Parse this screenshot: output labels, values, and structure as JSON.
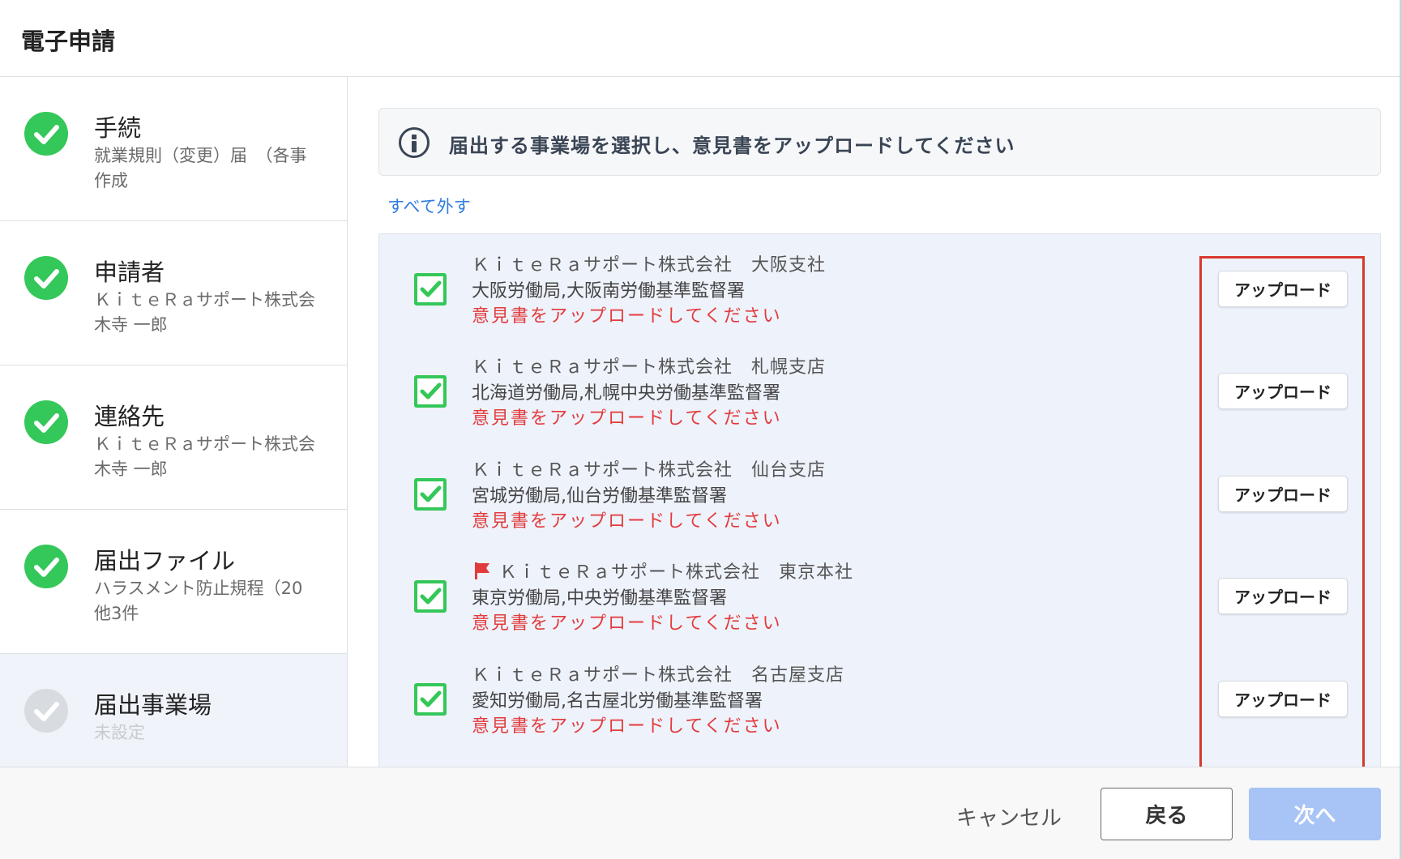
{
  "header": {
    "title": "電子申請"
  },
  "sidebar": {
    "steps": [
      {
        "title": "手続",
        "sub1": "就業規則（変更）届　（各事",
        "sub2": "作成",
        "status": "done"
      },
      {
        "title": "申請者",
        "sub1": "ＫｉｔｅＲａサポート株式会",
        "sub2": "木寺 一郎",
        "status": "done"
      },
      {
        "title": "連絡先",
        "sub1": "ＫｉｔｅＲａサポート株式会",
        "sub2": "木寺 一郎",
        "status": "done"
      },
      {
        "title": "届出ファイル",
        "sub1": "ハラスメント防止規程（20",
        "sub2": "他3件",
        "status": "done"
      },
      {
        "title": "届出事業場",
        "sub1": "未設定",
        "status": "pending"
      }
    ]
  },
  "main": {
    "info_message": "届出する事業場を選択し、意見書をアップロードしてください",
    "clear_all_label": "すべて外す",
    "upload_label": "アップロード",
    "offices": [
      {
        "company": "ＫｉｔｅＲａサポート株式会社　大阪支社",
        "office": "大阪労働局,大阪南労働基準監督署",
        "warning": "意見書をアップロードしてください",
        "checked": true,
        "flag": false
      },
      {
        "company": "ＫｉｔｅＲａサポート株式会社　札幌支店",
        "office": "北海道労働局,札幌中央労働基準監督署",
        "warning": "意見書をアップロードしてください",
        "checked": true,
        "flag": false
      },
      {
        "company": "ＫｉｔｅＲａサポート株式会社　仙台支店",
        "office": "宮城労働局,仙台労働基準監督署",
        "warning": "意見書をアップロードしてください",
        "checked": true,
        "flag": false
      },
      {
        "company": "ＫｉｔｅＲａサポート株式会社　東京本社",
        "office": "東京労働局,中央労働基準監督署",
        "warning": "意見書をアップロードしてください",
        "checked": true,
        "flag": true
      },
      {
        "company": "ＫｉｔｅＲａサポート株式会社　名古屋支店",
        "office": "愛知労働局,名古屋北労働基準監督署",
        "warning": "意見書をアップロードしてください",
        "checked": true,
        "flag": false
      }
    ]
  },
  "footer": {
    "cancel_label": "キャンセル",
    "back_label": "戻る",
    "next_label": "次へ"
  },
  "colors": {
    "success": "#34c759",
    "warning": "#e23b3b",
    "link": "#2f7de1",
    "primary_disabled": "#a8c3f5",
    "highlight": "#d9382e"
  },
  "icons": {
    "step_done": "check-circle-icon",
    "step_pending": "check-circle-icon",
    "row_checkbox": "checked-checkbox-icon",
    "flag": "flag-icon",
    "info": "info-icon"
  }
}
